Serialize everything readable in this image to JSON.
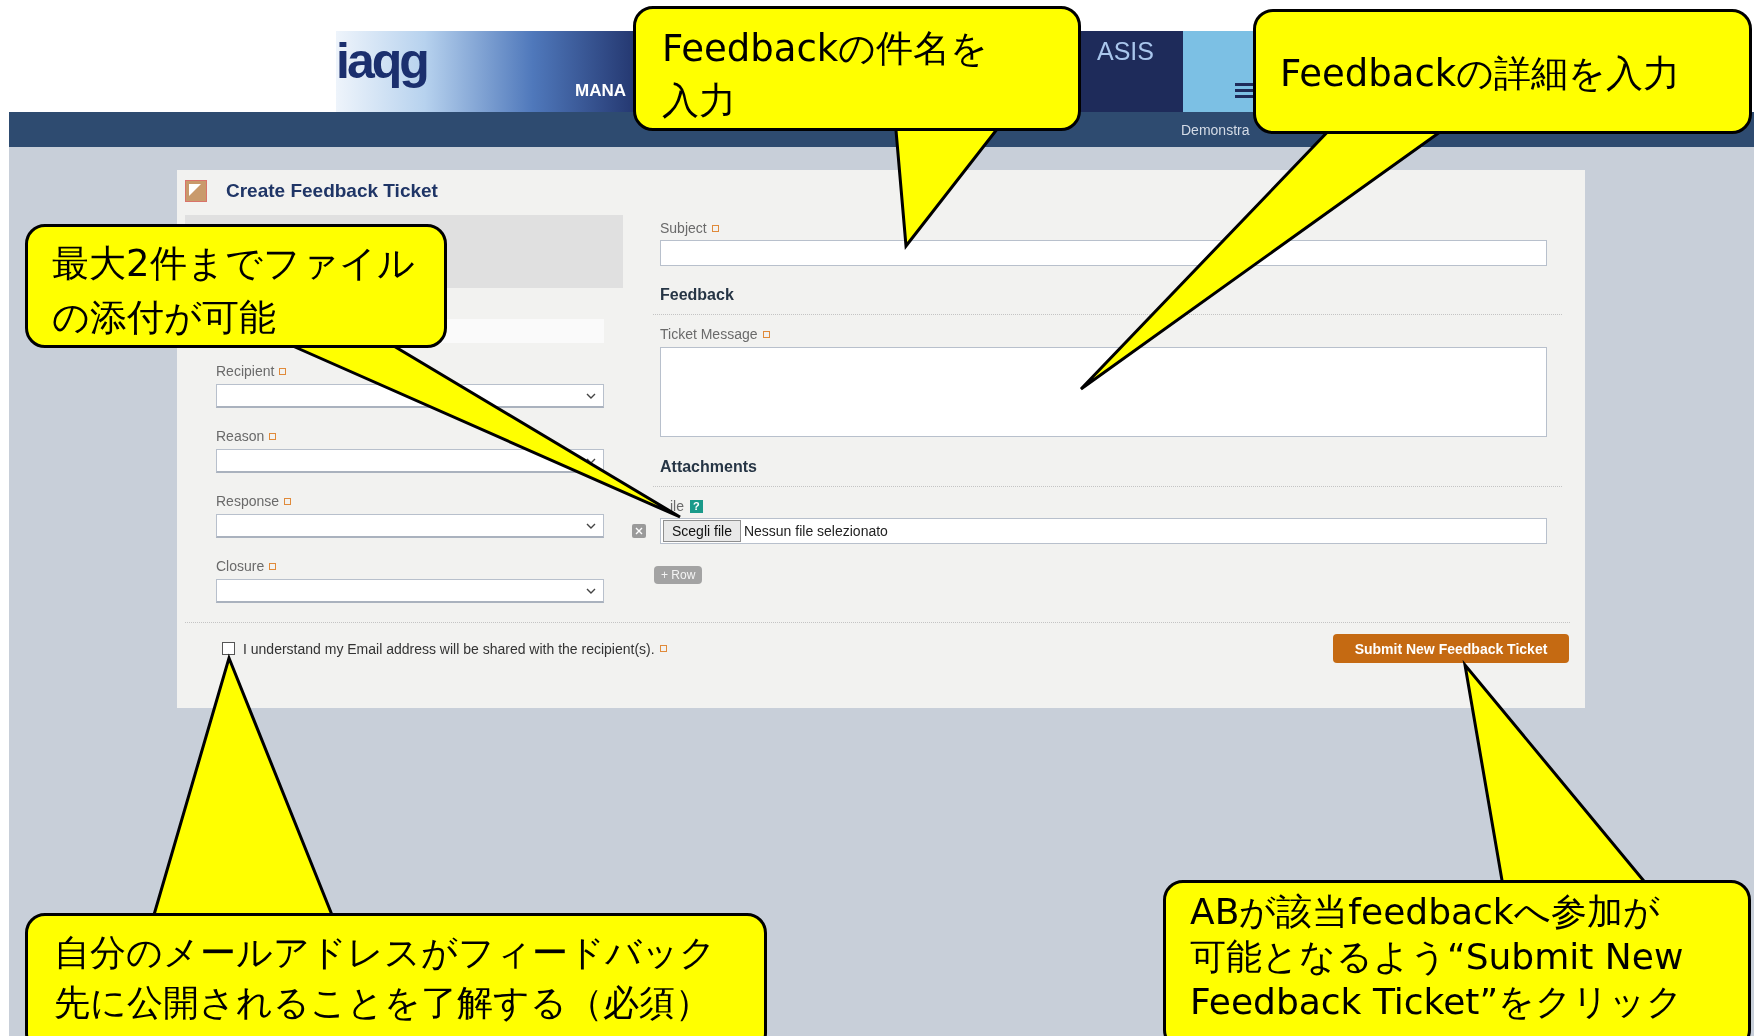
{
  "header": {
    "logo": "iaqg",
    "nav_text": "MANA",
    "brand": "ASIS",
    "user": "Demonstra"
  },
  "form": {
    "title": "Create Feedback Ticket",
    "left_fields": [
      {
        "label": "Recipient",
        "required": true
      },
      {
        "label": "Reason",
        "required": true
      },
      {
        "label": "Response",
        "required": true
      },
      {
        "label": "Closure",
        "required": true
      }
    ],
    "subject": {
      "label": "Subject",
      "required": true
    },
    "feedback_heading": "Feedback",
    "message": {
      "label": "Ticket Message",
      "required": true
    },
    "attachments_heading": "Attachments",
    "file": {
      "label": "ile",
      "help": "?",
      "button": "Scegli file",
      "status": "Nessun file selezionato"
    },
    "add_row_button": "+ Row",
    "consent": {
      "text": "I understand my Email address will be shared with the recipient(s).",
      "checked": false,
      "required": true
    },
    "submit_button": "Submit New Feedback Ticket"
  },
  "callouts": [
    {
      "text": "Feedbackの件名を入力"
    },
    {
      "text": "Feedbackの詳細を入力"
    },
    {
      "text": "最大2件までファイルの添付が可能"
    },
    {
      "text": "自分のメールアドレスがフィードバック先に公開されることを了解する（必須）"
    },
    {
      "text": "ABが該当feedbackへ参加が可能となるよう“Submit New Feedback Ticket”をクリック"
    }
  ]
}
